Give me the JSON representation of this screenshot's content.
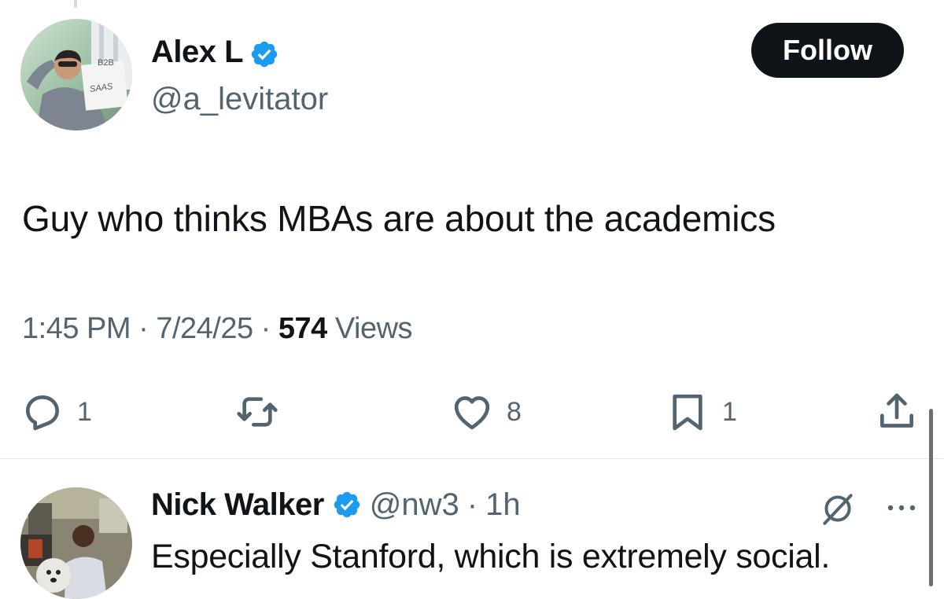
{
  "tweet": {
    "author": {
      "name": "Alex L",
      "handle": "@a_levitator",
      "avatar_sign_top": "B2B",
      "avatar_sign_bottom": "SAAS"
    },
    "follow_label": "Follow",
    "text": "Guy who thinks MBAs are about the academics",
    "time": "1:45 PM",
    "date": "7/24/25",
    "separator": "·",
    "views_count": "574",
    "views_label": "Views",
    "actions": {
      "replies": "1",
      "likes": "8",
      "bookmarks": "1"
    }
  },
  "reply": {
    "name": "Nick Walker",
    "handle": "@nw3",
    "separator": "·",
    "time": "1h",
    "text": "Especially Stanford, which is extremely social."
  },
  "colors": {
    "text_primary": "#0f1419",
    "text_secondary": "#536471",
    "verified_blue": "#1d9bf0",
    "follow_bg": "#0f1419",
    "divider": "#e6e9ec"
  },
  "icons": {
    "verified": "verified-badge-icon",
    "reply": "reply-icon",
    "retweet": "retweet-icon",
    "like": "heart-icon",
    "bookmark": "bookmark-icon",
    "share": "share-icon",
    "grok": "grok-icon",
    "more": "more-icon"
  }
}
